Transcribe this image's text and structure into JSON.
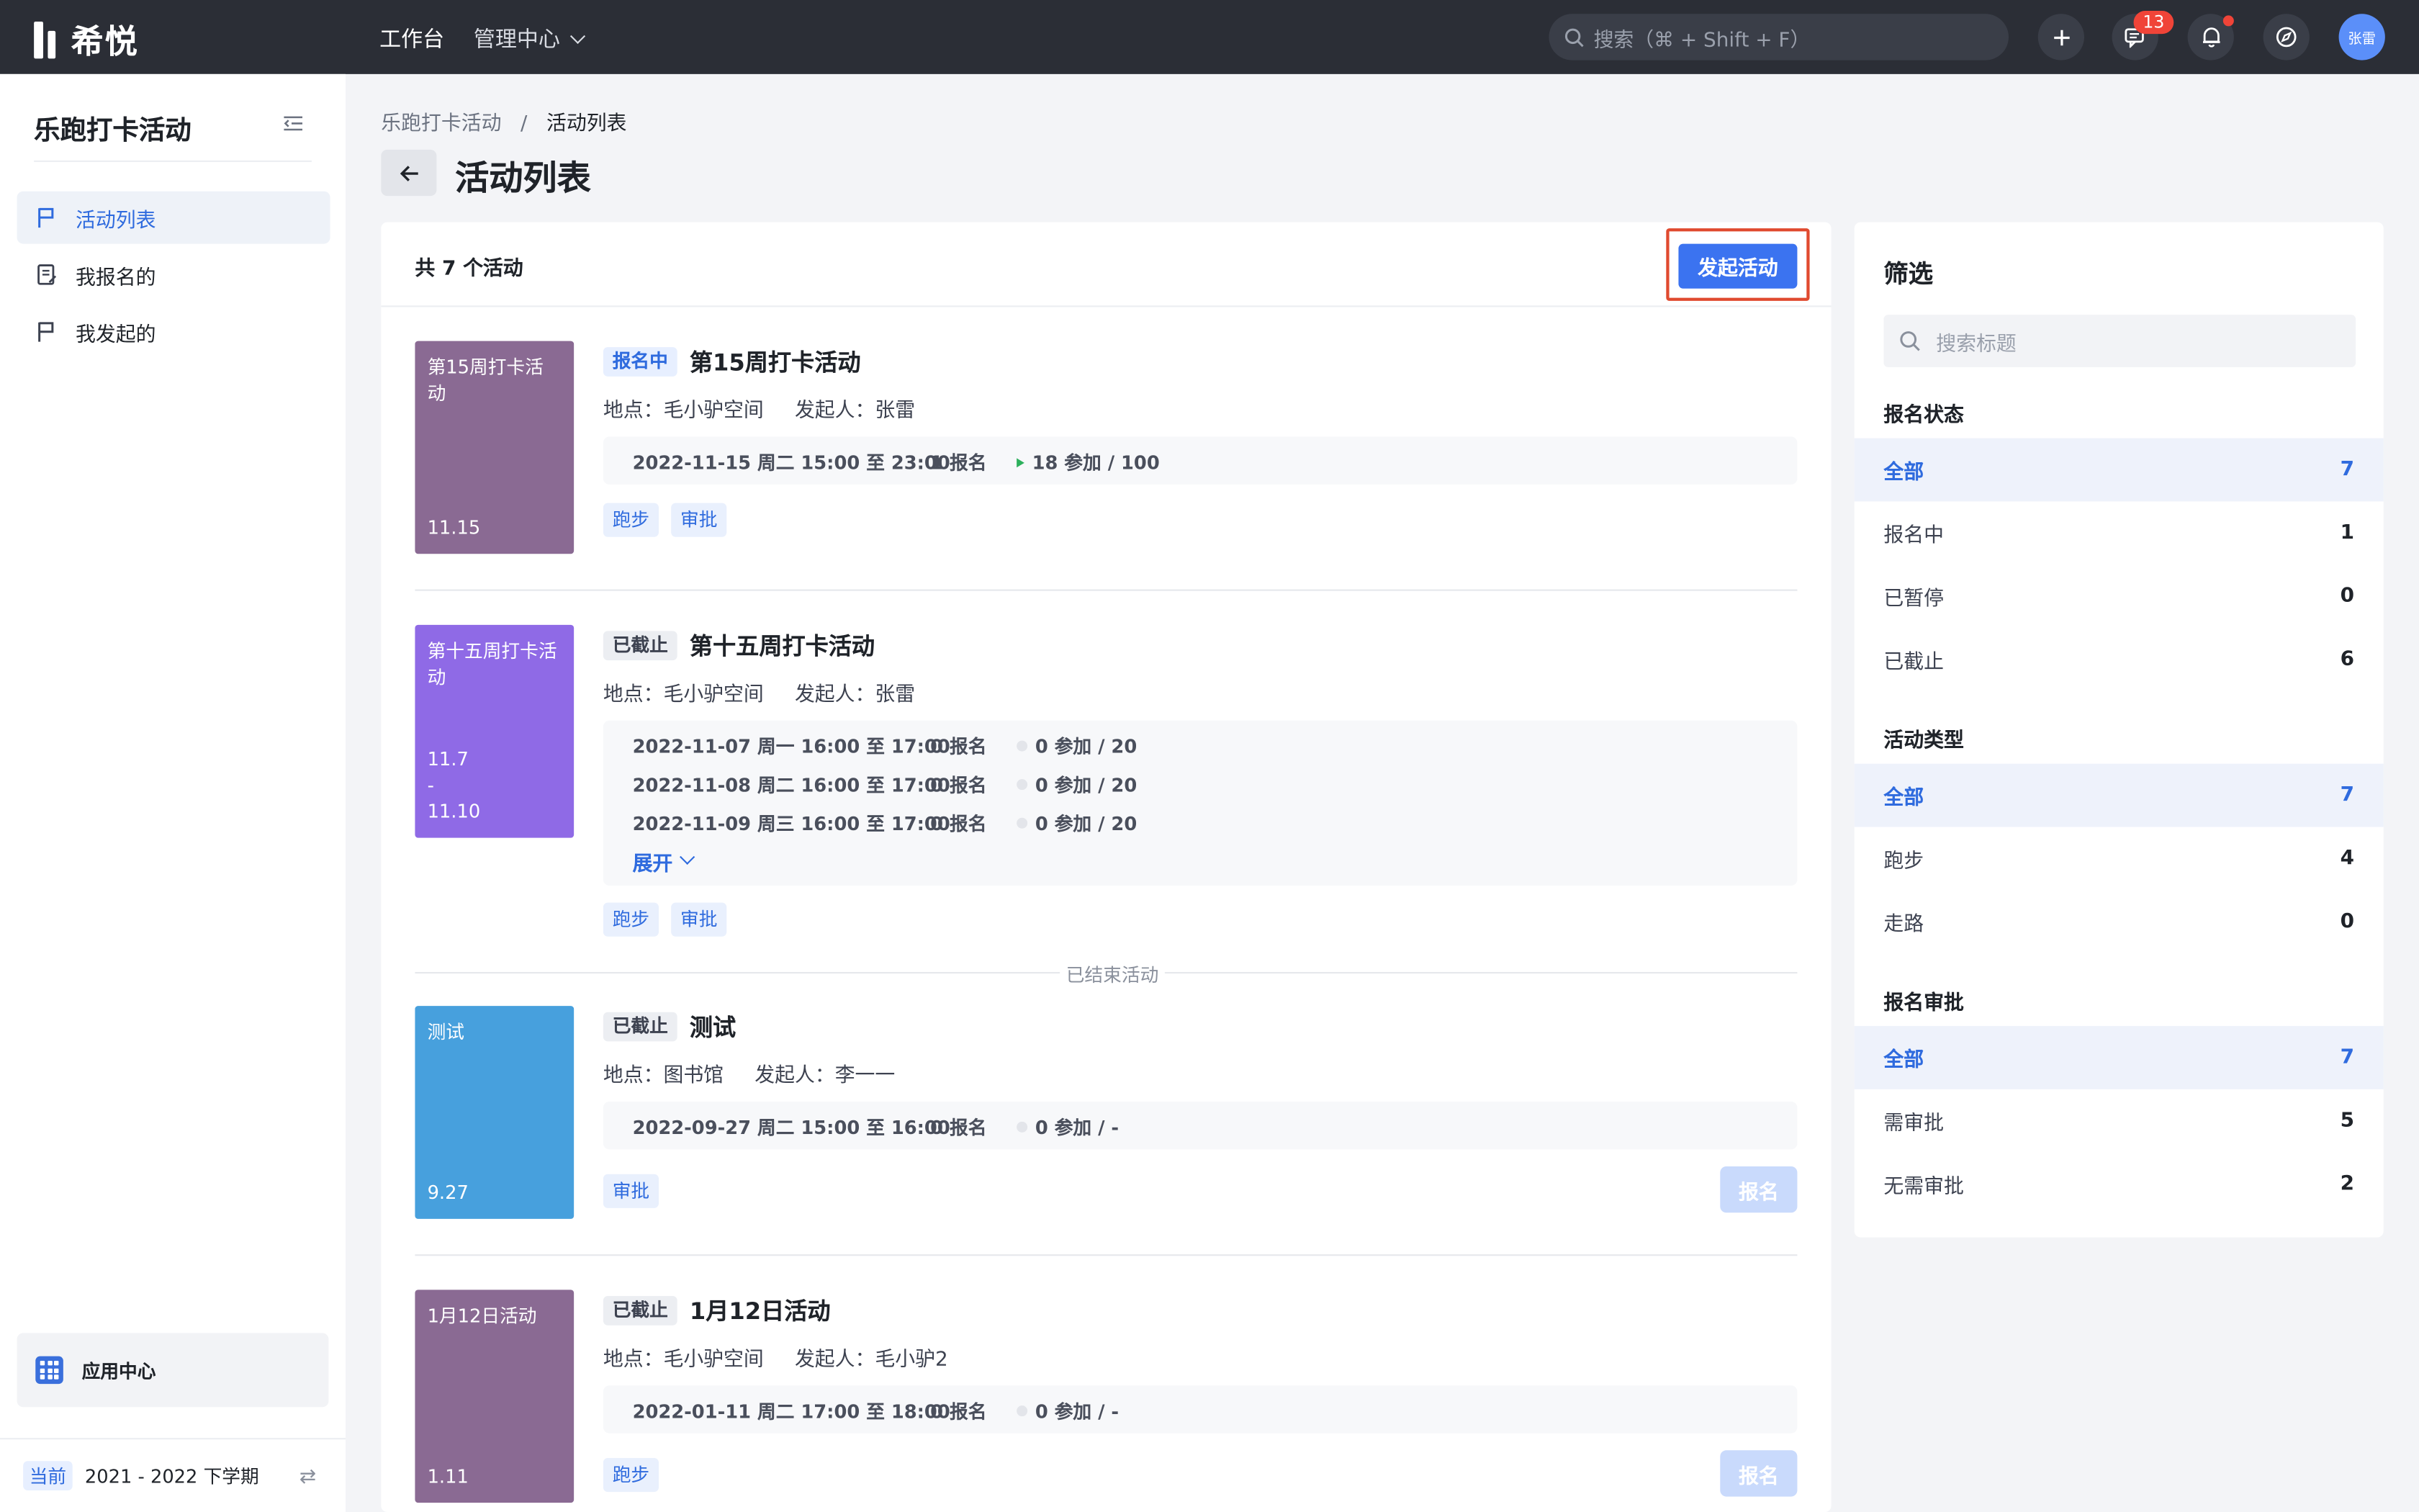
{
  "topbar": {
    "brand": "希悦",
    "nav": [
      "工作台",
      "管理中心"
    ],
    "search_placeholder": "搜索（⌘ + Shift + F）",
    "message_badge": "13",
    "avatar_text": "张雷"
  },
  "sidebar": {
    "title": "乐跑打卡活动",
    "items": [
      {
        "label": "活动列表",
        "icon": "flag-icon",
        "active": true
      },
      {
        "label": "我报名的",
        "icon": "form-icon",
        "active": false
      },
      {
        "label": "我发起的",
        "icon": "flag-icon",
        "active": false
      }
    ],
    "app_center": "应用中心",
    "term_tag": "当前",
    "term": "2021 - 2022 下学期"
  },
  "breadcrumb": [
    "乐跑打卡活动",
    "活动列表"
  ],
  "page_title": "活动列表",
  "list": {
    "count_label": "共 7 个活动",
    "launch_button": "发起活动",
    "ended_divider": "已结束活动",
    "location_prefix": "地点：",
    "initiator_prefix": "发起人：",
    "expand_label": "展开",
    "signup_button": "报名",
    "activities": [
      {
        "cover_title": "第15周打卡活动",
        "cover_date": "11.15",
        "cover_color": "#8a6a93",
        "status": "报名中",
        "title": "第15周打卡活动",
        "location": "毛小驴空间",
        "initiator": "张雷",
        "sessions": [
          {
            "time": "2022-11-15 周二 15:00 至 23:00",
            "signups": "1 报名",
            "participants": "18 参加 / 100"
          }
        ],
        "tags": [
          "跑步",
          "审批"
        ]
      },
      {
        "cover_title": "第十五周打卡活动",
        "cover_date": "11.7\n-\n11.10",
        "cover_color": "#8f6ae6",
        "status": "已截止",
        "title": "第十五周打卡活动",
        "location": "毛小驴空间",
        "initiator": "张雷",
        "sessions": [
          {
            "time": "2022-11-07 周一 16:00 至 17:00",
            "signups": "0 报名",
            "participants": "0 参加 / 20"
          },
          {
            "time": "2022-11-08 周二 16:00 至 17:00",
            "signups": "0 报名",
            "participants": "0 参加 / 20"
          },
          {
            "time": "2022-11-09 周三 16:00 至 17:00",
            "signups": "0 报名",
            "participants": "0 参加 / 20"
          }
        ],
        "tags": [
          "跑步",
          "审批"
        ]
      },
      {
        "cover_title": "测试",
        "cover_date": "9.27",
        "cover_color": "#47a0dd",
        "status": "已截止",
        "title": "测试",
        "location": "图书馆",
        "initiator": "李一一",
        "sessions": [
          {
            "time": "2022-09-27 周二 15:00 至 16:00",
            "signups": "0 报名",
            "participants": "0 参加 / -"
          }
        ],
        "tags": [
          "审批"
        ]
      },
      {
        "cover_title": "1月12日活动",
        "cover_date": "1.11",
        "cover_color": "#8a6a93",
        "status": "已截止",
        "title": "1月12日活动",
        "location": "毛小驴空间",
        "initiator": "毛小驴2",
        "sessions": [
          {
            "time": "2022-01-11 周二 17:00 至 18:00",
            "signups": "0 报名",
            "participants": "0 参加 / -"
          }
        ],
        "tags": [
          "跑步"
        ]
      }
    ]
  },
  "filter": {
    "title": "筛选",
    "search_placeholder": "搜索标题",
    "groups": [
      {
        "label": "报名状态",
        "options": [
          {
            "label": "全部",
            "count": "7",
            "selected": true
          },
          {
            "label": "报名中",
            "count": "1"
          },
          {
            "label": "已暂停",
            "count": "0"
          },
          {
            "label": "已截止",
            "count": "6"
          }
        ]
      },
      {
        "label": "活动类型",
        "options": [
          {
            "label": "全部",
            "count": "7",
            "selected": true
          },
          {
            "label": "跑步",
            "count": "4"
          },
          {
            "label": "走路",
            "count": "0"
          }
        ]
      },
      {
        "label": "报名审批",
        "options": [
          {
            "label": "全部",
            "count": "7",
            "selected": true
          },
          {
            "label": "需审批",
            "count": "5"
          },
          {
            "label": "无需审批",
            "count": "2"
          }
        ]
      }
    ]
  },
  "colors": {
    "accent": "#3b73f0",
    "highlight_border": "#e04a2f",
    "topbar": "#2b2e36"
  }
}
